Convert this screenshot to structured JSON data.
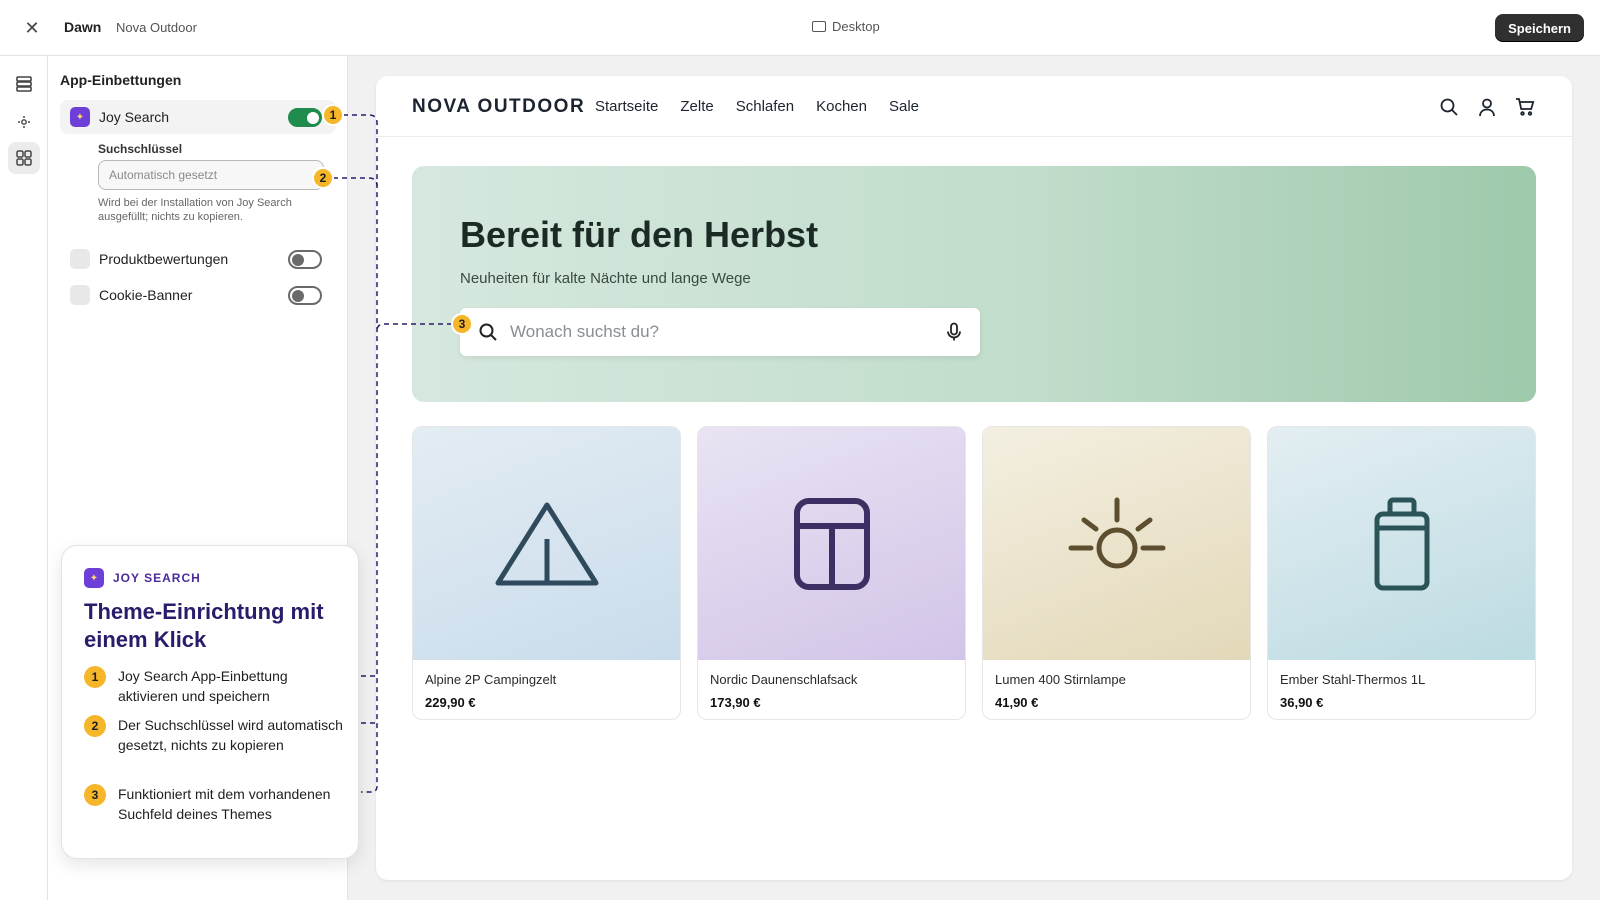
{
  "topbar": {
    "theme_name": "Dawn",
    "store_name": "Nova Outdoor",
    "device_label": "Desktop",
    "save_label": "Speichern"
  },
  "panel": {
    "title": "App-Einbettungen",
    "embeds": [
      {
        "label": "Joy Search",
        "enabled": true
      },
      {
        "label": "Produktbewertungen",
        "enabled": false
      },
      {
        "label": "Cookie-Banner",
        "enabled": false
      }
    ],
    "field_label": "Suchschlüssel",
    "field_placeholder": "Automatisch gesetzt",
    "field_help": "Wird bei der Installation von Joy Search ausgefüllt; nichts zu kopieren."
  },
  "badges": [
    "1",
    "2",
    "3"
  ],
  "callout": {
    "brand": "JOY SEARCH",
    "title": "Theme-Einrichtung mit einem Klick",
    "steps": [
      {
        "num": "1",
        "text": "Joy Search App-Einbettung aktivieren und speichern"
      },
      {
        "num": "2",
        "text": "Der Suchschlüssel wird automatisch gesetzt, nichts zu kopieren"
      },
      {
        "num": "3",
        "text": "Funktioniert mit dem vorhandenen Suchfeld deines Themes"
      }
    ]
  },
  "store": {
    "logo": "NOVA OUTDOOR",
    "nav": [
      "Startseite",
      "Zelte",
      "Schlafen",
      "Kochen",
      "Sale"
    ],
    "hero_title": "Bereit für den Herbst",
    "hero_subtitle": "Neuheiten für kalte Nächte und lange Wege",
    "search_placeholder": "Wonach suchst du?",
    "products": [
      {
        "name": "Alpine 2P Campingzelt",
        "price": "229,90 €",
        "icon": "tent-icon"
      },
      {
        "name": "Nordic Daunenschlafsack",
        "price": "173,90 €",
        "icon": "sleeping-bag-icon"
      },
      {
        "name": "Lumen 400 Stirnlampe",
        "price": "41,90 €",
        "icon": "lamp-icon"
      },
      {
        "name": "Ember Stahl-Thermos 1L",
        "price": "36,90 €",
        "icon": "thermos-icon"
      }
    ]
  },
  "colors": {
    "accent_purple": "#6d3fd8",
    "badge_yellow": "#f5b62a",
    "toggle_green": "#1f8b4c",
    "callout_title": "#2a1c6b"
  }
}
